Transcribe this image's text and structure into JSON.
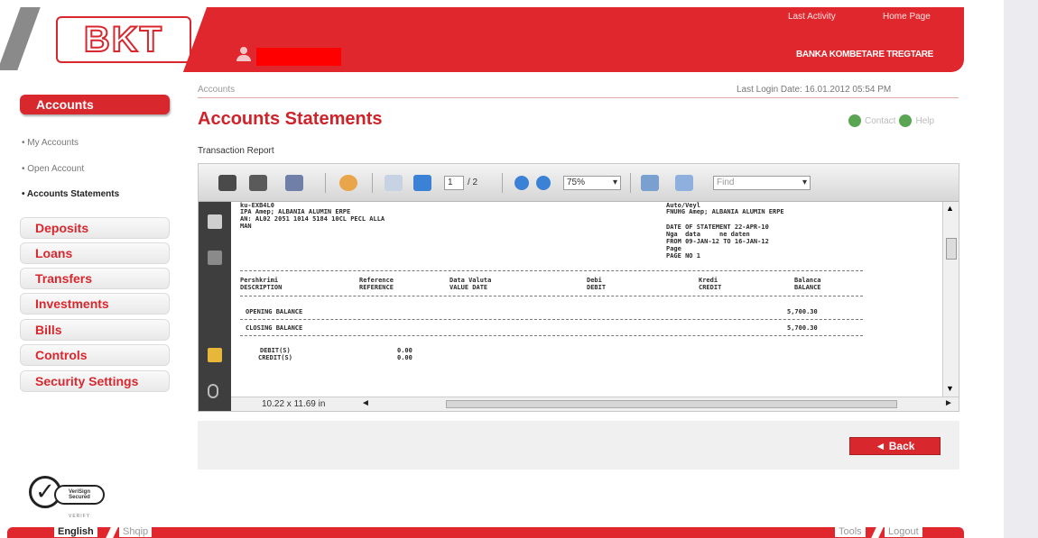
{
  "header": {
    "logo_text": "BKT",
    "top_links": [
      "Last Activity",
      "Home Page"
    ],
    "bank_name": "BANKA KOMBETARE TREGTARE"
  },
  "nav": {
    "active": "Accounts",
    "sub_items": [
      "My Accounts",
      "Open Account",
      "Accounts Statements"
    ],
    "selected_sub": "Accounts Statements",
    "tabs": [
      "Deposits",
      "Loans",
      "Transfers",
      "Investments",
      "Bills",
      "Controls",
      "Security Settings"
    ]
  },
  "main": {
    "breadcrumb": "Accounts",
    "last_login_label": "Last Login Date:",
    "last_login_value": "16.01.2012 05:54 PM",
    "title": "Accounts Statements",
    "contact": "Contact",
    "help": "Help",
    "subtitle": "Transaction Report"
  },
  "viewer": {
    "page_current": "1",
    "page_total": "/ 2",
    "zoom": "75%",
    "find_placeholder": "Find",
    "page_size": "10.22 x 11.69 in",
    "doc": {
      "left_header": [
        "ku-EXB4L0",
        "IPA Amep; ALBANIA ALUMIN ERPE",
        "AN: AL02 2051 1014 5184 10CL PECL ALLA",
        "MAN"
      ],
      "right_header": [
        "Auto/Veyl",
        "FNUHG Amep; ALBANIA ALUMIN ERPE"
      ],
      "statement_info": [
        "DATE OF STATEMENT 22-APR-10",
        "Nga  data     ne daten",
        "FROM 09-JAN-12 TO 16-JAN-12",
        "Page",
        "PAGE NO 1"
      ],
      "columns": [
        [
          "Pershkrimi",
          "DESCRIPTION"
        ],
        [
          "Reference",
          "REFERENCE"
        ],
        [
          "Data Valuta",
          "VALUE DATE"
        ],
        [
          "Debi",
          "DEBIT"
        ],
        [
          "Kredi",
          "CREDIT"
        ],
        [
          "Balanca",
          "BALANCE"
        ]
      ],
      "opening_label": "OPENING BALANCE",
      "opening_value": "5,700.30",
      "closing_label": "CLOSING BALANCE",
      "closing_value": "5,700.30",
      "totals": [
        {
          "label": "DEBIT(S)",
          "value": "0.00"
        },
        {
          "label": "CREDIT(S)",
          "value": "0.00"
        }
      ]
    }
  },
  "actions": {
    "back": "◄ Back"
  },
  "footer": {
    "verisign": [
      "VeriSign",
      "Secured"
    ],
    "verisign_sub": "VERIFY",
    "languages": [
      "English",
      "Shqip"
    ],
    "right_links": [
      "Tools",
      "Logout"
    ]
  },
  "colors": {
    "brand_red": "#e0272d",
    "title_red": "#cf2229",
    "nav_tab_text": "#d9272e"
  }
}
